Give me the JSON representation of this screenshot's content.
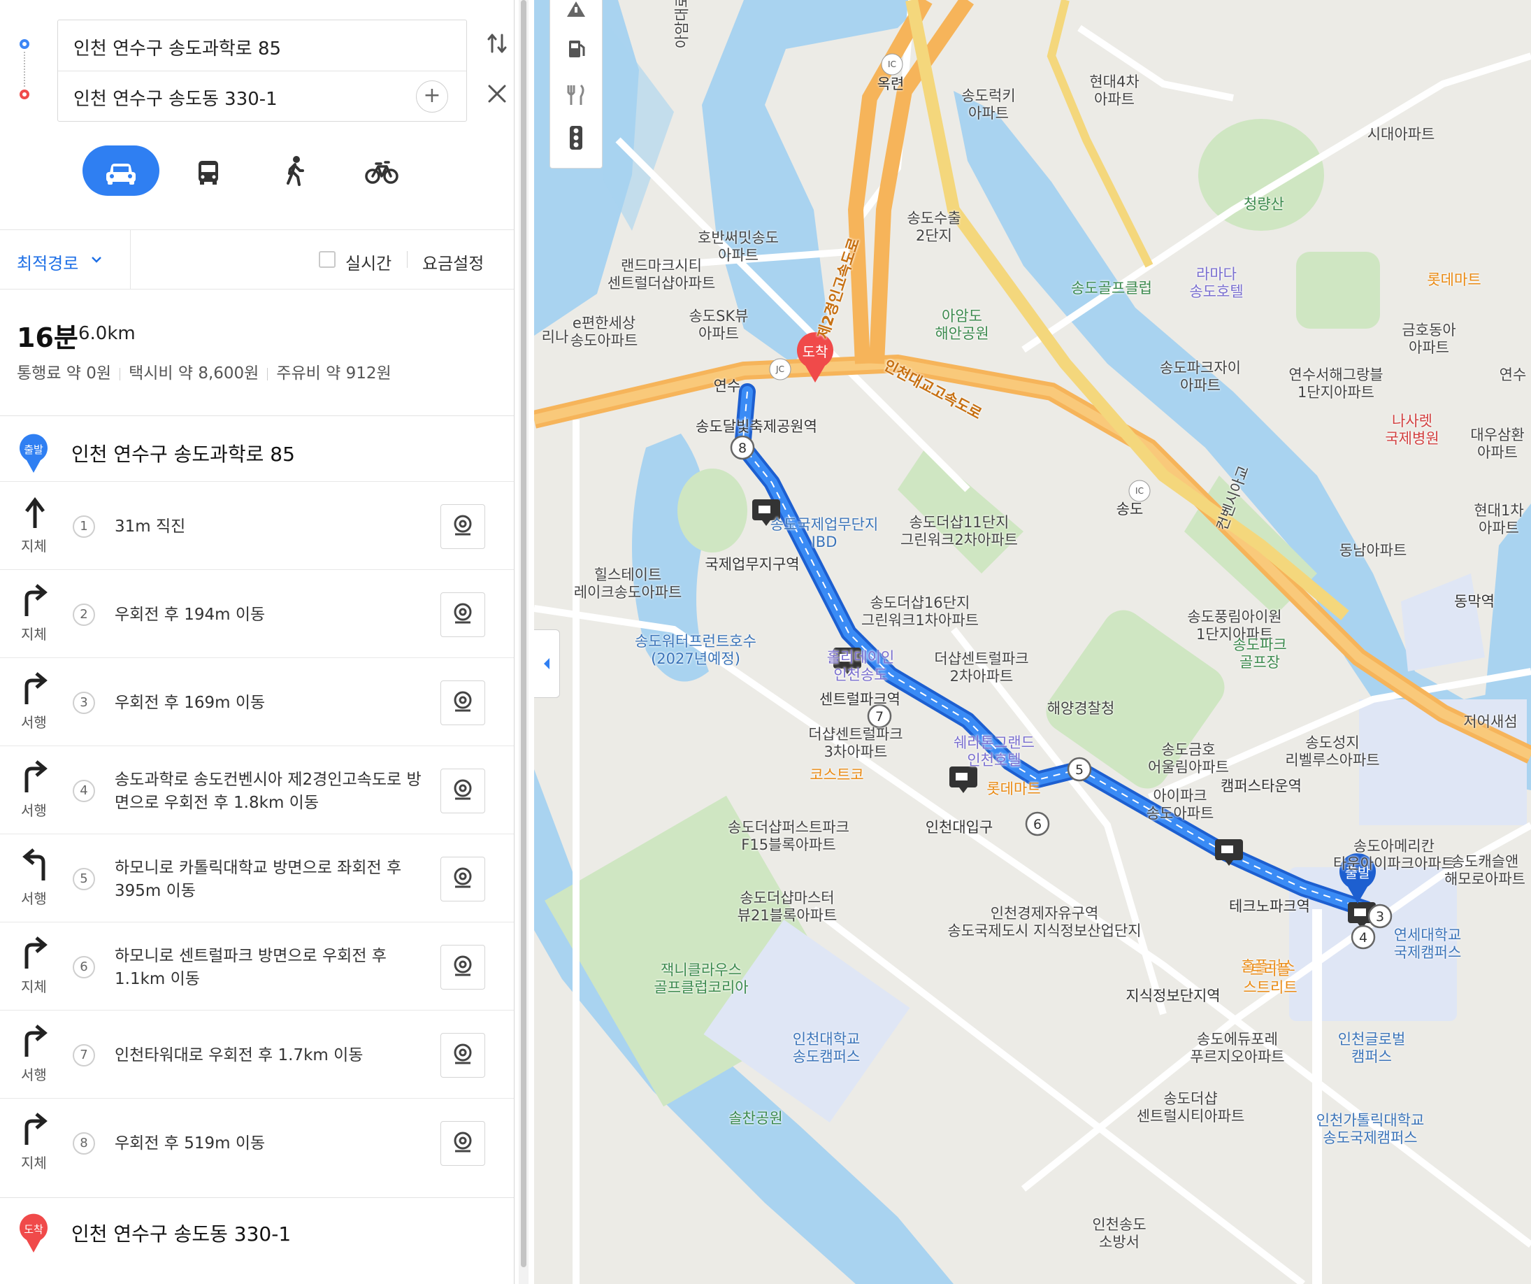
{
  "search": {
    "origin": "인천 연수구 송도과학로 85",
    "destination": "인천 연수구 송도동 330-1"
  },
  "icons": {
    "swap": "swap-icon",
    "close": "close-icon",
    "add": "add-waypoint-icon",
    "modes": [
      "car-icon",
      "bus-icon",
      "walk-icon",
      "bicycle-icon"
    ]
  },
  "options": {
    "route_type": "최적경로",
    "realtime": "실시간",
    "fare_settings": "요금설정"
  },
  "summary": {
    "time": "16분",
    "distance": "6.0km",
    "toll": "통행료 약 0원",
    "taxi": "택시비 약 8,600원",
    "fuel": "주유비 약 912원"
  },
  "start": {
    "badge": "출발",
    "name": "인천 연수구 송도과학로 85"
  },
  "end": {
    "badge": "도착",
    "name": "인천 연수구 송도동 330-1"
  },
  "steps": [
    {
      "num": "1",
      "arrow": "straight",
      "traffic": "지체",
      "desc": "31m 직진"
    },
    {
      "num": "2",
      "arrow": "right",
      "traffic": "지체",
      "desc": "우회전 후 194m 이동"
    },
    {
      "num": "3",
      "arrow": "right",
      "traffic": "서행",
      "desc": "우회전 후 169m 이동"
    },
    {
      "num": "4",
      "arrow": "right",
      "traffic": "서행",
      "desc": "송도과학로 송도컨벤시아 제2경인고속도로 방면으로 우회전 후 1.8km 이동"
    },
    {
      "num": "5",
      "arrow": "left",
      "traffic": "서행",
      "desc": "하모니로 카톨릭대학교 방면으로 좌회전 후 395m 이동"
    },
    {
      "num": "6",
      "arrow": "right",
      "traffic": "지체",
      "desc": "하모니로 센트럴파크 방면으로 우회전 후 1.1km 이동"
    },
    {
      "num": "7",
      "arrow": "right",
      "traffic": "서행",
      "desc": "인천타워대로 우회전 후 1.7km 이동"
    },
    {
      "num": "8",
      "arrow": "right",
      "traffic": "지체",
      "desc": "우회전 후 519m 이동"
    }
  ],
  "map": {
    "route_color": "#2f7ff2",
    "start_pin": "출발",
    "end_pin": "도착",
    "waypoints": [
      "8",
      "7",
      "5",
      "6",
      "4",
      "3"
    ],
    "road_badges": [
      "IC",
      "JC",
      "IC"
    ],
    "labels": [
      {
        "text": "옥련",
        "cls": "station"
      },
      {
        "text": "송도럭키\n아파트",
        "cls": ""
      },
      {
        "text": "현대4차\n아파트",
        "cls": ""
      },
      {
        "text": "시대아파트",
        "cls": ""
      },
      {
        "text": "청량산",
        "cls": "green"
      },
      {
        "text": "송도수출\n2단지",
        "cls": ""
      },
      {
        "text": "호반써밋송도\n아파트",
        "cls": ""
      },
      {
        "text": "랜드마크시티\n센트럴더샵아파트",
        "cls": ""
      },
      {
        "text": "송도골프클럽",
        "cls": "green"
      },
      {
        "text": "라마다\n송도호텔",
        "cls": "purple"
      },
      {
        "text": "롯데마트",
        "cls": "orange"
      },
      {
        "text": "e편한세상\n송도아파트",
        "cls": ""
      },
      {
        "text": "송도SK뷰\n아파트",
        "cls": ""
      },
      {
        "text": "아암도\n해안공원",
        "cls": "green"
      },
      {
        "text": "금호동아\n아파트",
        "cls": ""
      },
      {
        "text": "송도파크자이\n아파트",
        "cls": ""
      },
      {
        "text": "연수서해그랑블\n1단지아파트",
        "cls": ""
      },
      {
        "text": "연수",
        "cls": ""
      },
      {
        "text": "연수",
        "cls": "station"
      },
      {
        "text": "인천대교고속도로",
        "cls": "road"
      },
      {
        "text": "제2경인고속도로",
        "cls": "road"
      },
      {
        "text": "나사렛\n국제병원",
        "cls": "red"
      },
      {
        "text": "대우삼환\n아파트",
        "cls": ""
      },
      {
        "text": "송도달빛축제공원역",
        "cls": "station"
      },
      {
        "text": "송도",
        "cls": "station"
      },
      {
        "text": "컨벤시아교",
        "cls": ""
      },
      {
        "text": "송도더샵11단지\n그린워크2차아파트",
        "cls": ""
      },
      {
        "text": "현대1차\n아파트",
        "cls": ""
      },
      {
        "text": "송도국제업무단지\nIBD",
        "cls": "blue"
      },
      {
        "text": "동남아파트",
        "cls": ""
      },
      {
        "text": "국제업무지구역",
        "cls": "station"
      },
      {
        "text": "힐스테이트\n레이크송도아파트",
        "cls": ""
      },
      {
        "text": "송도더샵16단지\n그린워크1차아파트",
        "cls": ""
      },
      {
        "text": "송도풍림아이원\n1단지아파트",
        "cls": ""
      },
      {
        "text": "동막역",
        "cls": "station"
      },
      {
        "text": "송도워터프런트호수\n(2027년예정)",
        "cls": "blue"
      },
      {
        "text": "홀리데이인\n인천송도",
        "cls": "purple"
      },
      {
        "text": "더샵센트럴파크\n2차아파트",
        "cls": ""
      },
      {
        "text": "송도파크\n골프장",
        "cls": "green"
      },
      {
        "text": "센트럴파크역",
        "cls": "station"
      },
      {
        "text": "해양경찰청",
        "cls": ""
      },
      {
        "text": "더샵센트럴파크\n3차아파트",
        "cls": ""
      },
      {
        "text": "쉐라톤그랜드\n인천호텔",
        "cls": "purple"
      },
      {
        "text": "송도금호\n어울림아파트",
        "cls": ""
      },
      {
        "text": "송도성지\n리벨루스아파트",
        "cls": ""
      },
      {
        "text": "저어새섬",
        "cls": ""
      },
      {
        "text": "코스트코",
        "cls": "orange"
      },
      {
        "text": "롯데마트",
        "cls": "orange"
      },
      {
        "text": "아이파크\n송도아파트",
        "cls": ""
      },
      {
        "text": "캠퍼스타운역",
        "cls": "station"
      },
      {
        "text": "송도더샵퍼스트파크\nF15블록아파트",
        "cls": ""
      },
      {
        "text": "인천대입구",
        "cls": "station"
      },
      {
        "text": "송도아메리칸\n타운아이파크아파트",
        "cls": ""
      },
      {
        "text": "송도캐슬앤\n해모로아파트",
        "cls": ""
      },
      {
        "text": "송도더샵마스터\n뷰21블록아파트",
        "cls": ""
      },
      {
        "text": "인천경제자유구역\n송도국제도시 지식정보산업단지",
        "cls": ""
      },
      {
        "text": "테크노파크역",
        "cls": "station"
      },
      {
        "text": "연세대학교\n국제캠퍼스",
        "cls": "blue"
      },
      {
        "text": "잭니클라우스\n골프클럽코리아",
        "cls": "green"
      },
      {
        "text": "홈플러스",
        "cls": "orange"
      },
      {
        "text": "트리플\n스트리트",
        "cls": "orange"
      },
      {
        "text": "지식정보단지역",
        "cls": "station"
      },
      {
        "text": "인천대학교\n송도캠퍼스",
        "cls": "blue"
      },
      {
        "text": "송도에듀포레\n푸르지오아파트",
        "cls": ""
      },
      {
        "text": "인천글로벌\n캠퍼스",
        "cls": "blue"
      },
      {
        "text": "송도더샵\n센트럴시티아파트",
        "cls": ""
      },
      {
        "text": "인천가톨릭대학교\n송도국제캠퍼스",
        "cls": "blue"
      },
      {
        "text": "솔찬공원",
        "cls": "green"
      },
      {
        "text": "인천송도\n소방서",
        "cls": ""
      },
      {
        "text": "아암대로",
        "cls": ""
      },
      {
        "text": "리나",
        "cls": ""
      }
    ]
  }
}
